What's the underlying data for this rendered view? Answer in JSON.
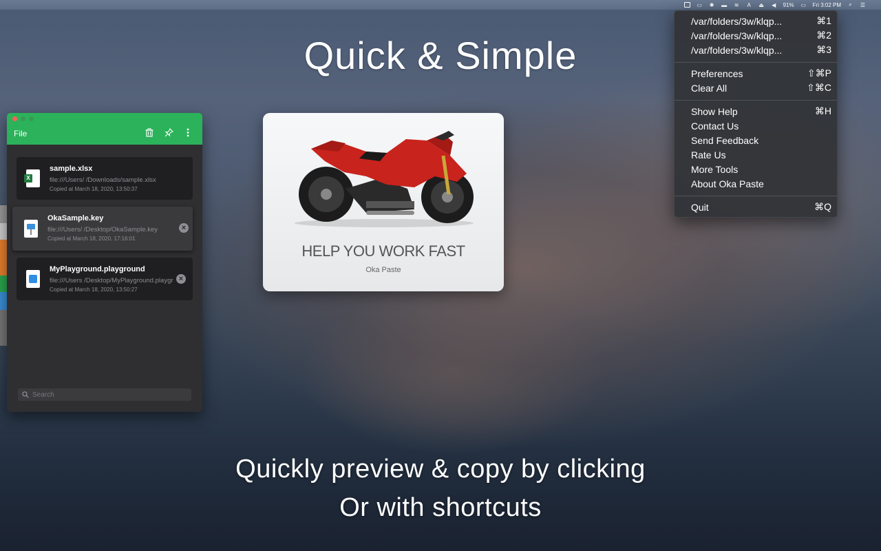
{
  "menubar": {
    "battery": "91%",
    "clock": "Fri 3:02 PM"
  },
  "hero": {
    "title": "Quick & Simple",
    "line1": "Quickly preview & copy by clicking",
    "line2": "Or with shortcuts"
  },
  "app": {
    "title": "File",
    "items": [
      {
        "name": "sample.xlsx",
        "path": "file:///Users/          /Downloads/sample.xlsx",
        "time": "Copied at March 18, 2020, 13:50:37",
        "icon": "excel-file-icon"
      },
      {
        "name": "OkaSample.key",
        "path": "file:///Users/          /Desktop/OkaSample.key",
        "time": "Copied at March 18, 2020, 17:16:01",
        "icon": "keynote-file-icon"
      },
      {
        "name": "MyPlayground.playground",
        "path": "file:///Users          /Desktop/MyPlayground.playground",
        "time": "Copied at March 18, 2020, 13:50:27",
        "icon": "swift-file-icon"
      }
    ],
    "search_placeholder": "Search"
  },
  "preview": {
    "headline": "HELP YOU WORK FAST",
    "subline": "Oka Paste"
  },
  "menu": {
    "recent": [
      {
        "label": "/var/folders/3w/klqp...",
        "shortcut": "⌘1"
      },
      {
        "label": "/var/folders/3w/klqp...",
        "shortcut": "⌘2"
      },
      {
        "label": "/var/folders/3w/klqp...",
        "shortcut": "⌘3"
      }
    ],
    "preferences": {
      "label": "Preferences",
      "shortcut": "⇧⌘P"
    },
    "clear_all": {
      "label": "Clear All",
      "shortcut": "⇧⌘C"
    },
    "show_help": {
      "label": "Show Help",
      "shortcut": "⌘H"
    },
    "contact_us": {
      "label": "Contact Us"
    },
    "send_feedback": {
      "label": "Send Feedback"
    },
    "rate_us": {
      "label": "Rate Us"
    },
    "more_tools": {
      "label": "More Tools"
    },
    "about": {
      "label": "About Oka Paste"
    },
    "quit": {
      "label": "Quit",
      "shortcut": "⌘Q"
    }
  },
  "colors": {
    "app_header": "#2bb25a",
    "moto_red": "#c8231c"
  }
}
